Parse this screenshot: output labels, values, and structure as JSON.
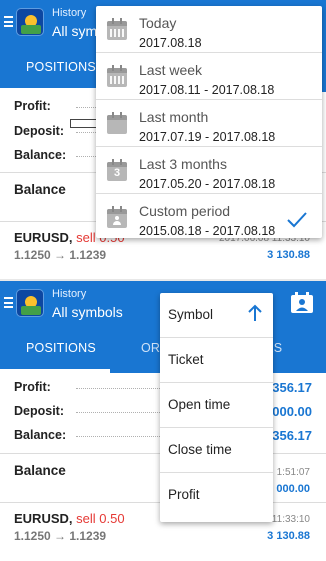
{
  "top": {
    "app": {
      "title": "History",
      "subtitle": "All symb"
    },
    "tabs": {
      "positions": "POSITIONS"
    },
    "summary": {
      "profit_label": "Profit:",
      "deposit_label": "Deposit:",
      "balance_label": "Balance:"
    },
    "balance_section": {
      "label": "Balance"
    },
    "deal": {
      "symbol": "EURUSD,",
      "side": "sell 0.50",
      "prices": "1.1250 → 1.1239",
      "amount": "3 130.88",
      "time_partial": "2017.06.08 11:33:10"
    },
    "period_menu": [
      {
        "title": "Today",
        "dates": "2017.08.18",
        "icon": "calendar-icon"
      },
      {
        "title": "Last week",
        "dates": "2017.08.11 - 2017.08.18",
        "icon": "calendar-icon"
      },
      {
        "title": "Last month",
        "dates": "2017.07.19 - 2017.08.18",
        "icon": "calendar-icon"
      },
      {
        "title": "Last 3 months",
        "dates": "2017.05.20 - 2017.08.18",
        "icon": "calendar-3-icon",
        "badge": "3"
      },
      {
        "title": "Custom period",
        "dates": "2015.08.18 - 2017.08.18",
        "icon": "calendar-person-icon",
        "selected": true
      }
    ]
  },
  "bottom": {
    "app": {
      "title": "History",
      "subtitle": "All symbols"
    },
    "tabs": {
      "positions": "POSITIONS",
      "orders": "ORD",
      "deals": "ALS"
    },
    "summary": {
      "profit_label": "Profit:",
      "profit_value": "356.17",
      "deposit_label": "Deposit:",
      "deposit_value": "000.00",
      "balance_label": "Balance:",
      "balance_value": "356.17"
    },
    "balance_section": {
      "label": "Balance",
      "time": "1:51:07",
      "amount": "000.00"
    },
    "deal": {
      "symbol": "EURUSD,",
      "side": "sell 0.50",
      "prices": "1.1250 → 1.1239",
      "time": "2017.06.08 11:33:10",
      "amount": "3 130.88"
    },
    "sort_menu": [
      {
        "label": "Symbol",
        "active": true,
        "direction": "ascending"
      },
      {
        "label": "Ticket"
      },
      {
        "label": "Open time"
      },
      {
        "label": "Close time"
      },
      {
        "label": "Profit"
      }
    ]
  },
  "colors": {
    "appbar": "#1976d2",
    "accent": "#1976d2",
    "sell": "#e53935",
    "check": "#1976d2"
  }
}
